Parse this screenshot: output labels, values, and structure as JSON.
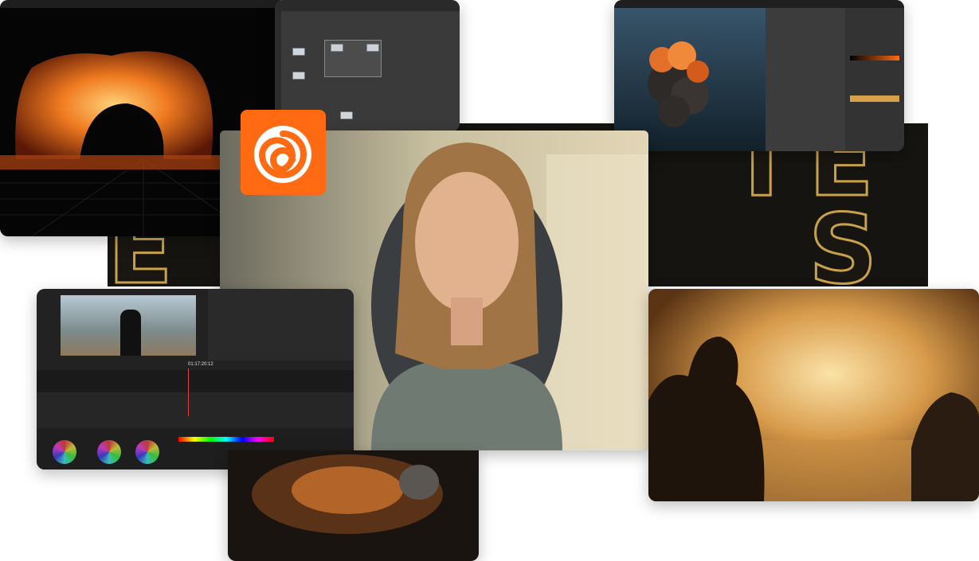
{
  "collage": {
    "houdini_logo_icon": "houdini-swirl",
    "accent_orange": "#ff6a13",
    "gold_outline": "#c8a24a"
  },
  "viewer": {
    "timecode": "01:17:20:12"
  }
}
